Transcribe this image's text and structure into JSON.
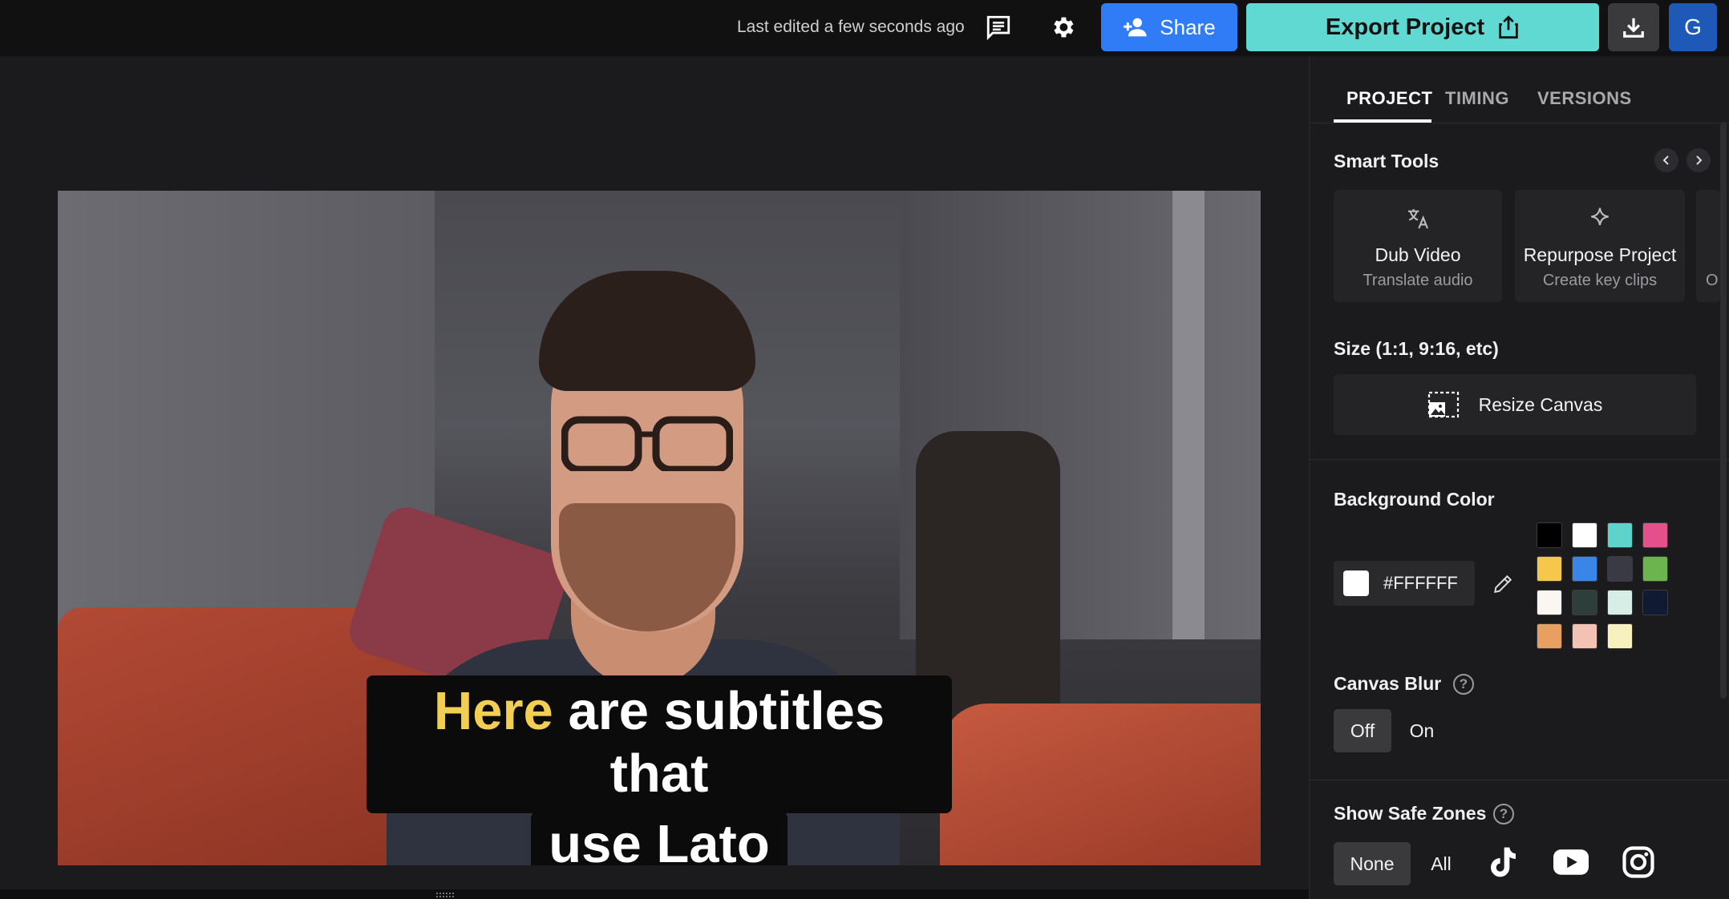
{
  "topbar": {
    "last_edited": "Last edited a few seconds ago",
    "comments_icon": "comments-icon",
    "settings_icon": "gear-icon",
    "share_label": "Share",
    "export_label": "Export Project",
    "download_icon": "download-icon",
    "avatar_initial": "G"
  },
  "video": {
    "subtitle_highlight": "Here",
    "subtitle_rest_line1": "are subtitles that",
    "subtitle_line2": "use Lato",
    "highlight_color": "#F2CF52"
  },
  "panel": {
    "tabs": [
      {
        "label": "PROJECT",
        "active": true
      },
      {
        "label": "TIMING",
        "active": false
      },
      {
        "label": "VERSIONS",
        "active": false
      }
    ],
    "smart_tools": {
      "title": "Smart Tools",
      "cards": [
        {
          "title": "Dub Video",
          "subtitle": "Translate audio",
          "icon": "translate-icon"
        },
        {
          "title": "Repurpose Project",
          "subtitle": "Create key clips",
          "icon": "sparkle-icon"
        },
        {
          "title": "",
          "subtitle": "O",
          "icon": ""
        }
      ]
    },
    "size": {
      "title": "Size (1:1, 9:16, etc)",
      "resize_label": "Resize Canvas"
    },
    "background": {
      "title": "Background Color",
      "hex_value": "#FFFFFF",
      "swatches": [
        "#000000",
        "#FFFFFF",
        "#5ED3CC",
        "#E6508A",
        "#F5C84B",
        "#3A86E8",
        "#3A3A44",
        "#6BB44E",
        "#FAF7F2",
        "#2E3E3A",
        "#D7EEE6",
        "#101A33",
        "#E8A060",
        "#F4C2B2",
        "#F6F1BE"
      ]
    },
    "canvas_blur": {
      "title": "Canvas Blur",
      "options": [
        "Off",
        "On"
      ],
      "selected": "Off"
    },
    "safe_zones": {
      "title": "Show Safe Zones",
      "options": [
        "None",
        "All"
      ],
      "selected": "None",
      "platform_icons": [
        "tiktok-icon",
        "youtube-icon",
        "instagram-icon"
      ]
    }
  }
}
